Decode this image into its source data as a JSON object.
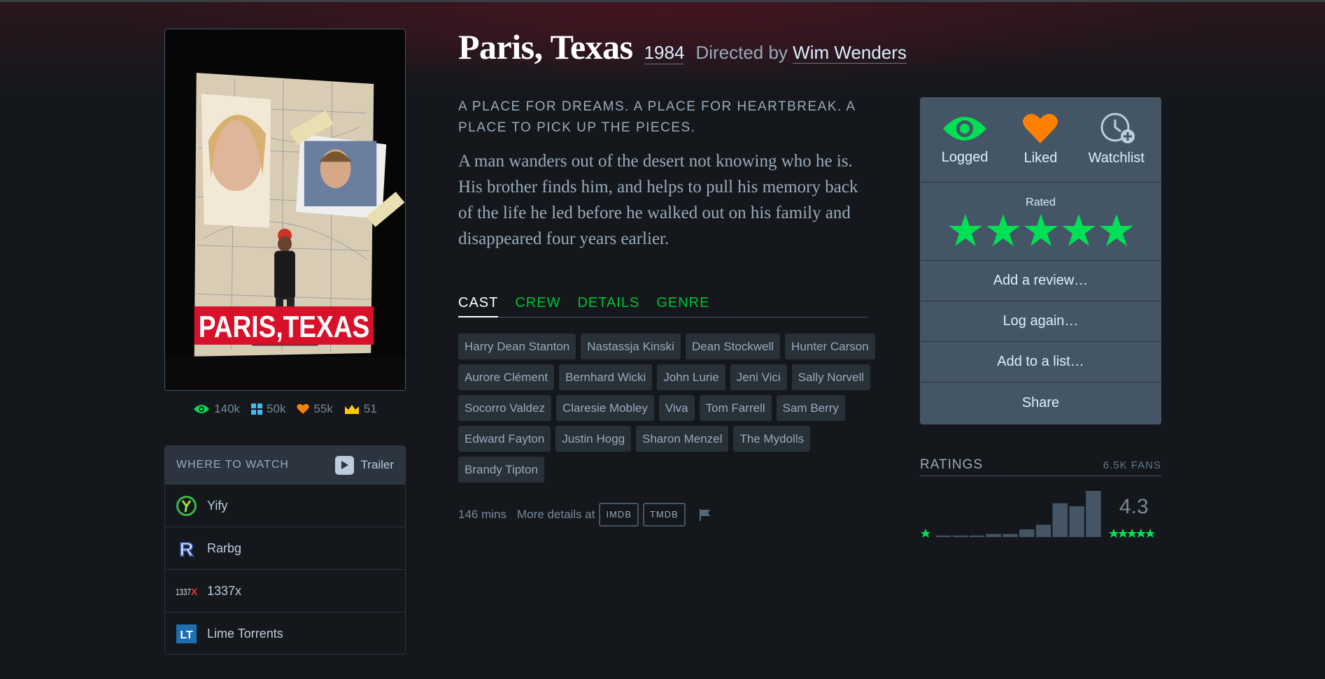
{
  "film": {
    "title": "Paris, Texas",
    "year": "1984",
    "directed_by_label": "Directed by",
    "director": "Wim Wenders",
    "tagline": "A PLACE FOR DREAMS. A PLACE FOR HEARTBREAK. A PLACE TO PICK UP THE PIECES.",
    "synopsis": "A man wanders out of the desert not knowing who he is. His brother finds him, and helps to pull his memory back of the life he led before he walked out on his family and disappeared four years earlier.",
    "poster_title": "PARIS,TEXAS"
  },
  "stats": {
    "watched": "140k",
    "lists": "50k",
    "likes": "55k",
    "top": "51"
  },
  "where_to_watch": {
    "title": "WHERE TO WATCH",
    "trailer_label": "Trailer",
    "services": [
      {
        "name": "Yify",
        "icon": "yify-icon"
      },
      {
        "name": "Rarbg",
        "icon": "rarbg-icon"
      },
      {
        "name": "1337x",
        "icon": "1337x-icon"
      },
      {
        "name": "Lime Torrents",
        "icon": "limetorrents-icon"
      }
    ],
    "icon_text": {
      "rarbg": "R",
      "x1337_a": "1337",
      "x1337_b": "X",
      "lime": "LT"
    }
  },
  "tabs": [
    {
      "label": "CAST",
      "active": true
    },
    {
      "label": "CREW",
      "active": false
    },
    {
      "label": "DETAILS",
      "active": false
    },
    {
      "label": "GENRE",
      "active": false
    }
  ],
  "cast": [
    "Harry Dean Stanton",
    "Nastassja Kinski",
    "Dean Stockwell",
    "Hunter Carson",
    "Aurore Clément",
    "Bernhard Wicki",
    "John Lurie",
    "Jeni Vici",
    "Sally Norvell",
    "Socorro Valdez",
    "Claresie Mobley",
    "Viva",
    "Tom Farrell",
    "Sam Berry",
    "Edward Fayton",
    "Justin Hogg",
    "Sharon Menzel",
    "The Mydolls",
    "Brandy Tipton"
  ],
  "meta": {
    "runtime": "146 mins",
    "more_details": "More details at",
    "imdb": "IMDB",
    "tmdb": "TMDB"
  },
  "actions": {
    "logged": "Logged",
    "liked": "Liked",
    "watchlist": "Watchlist",
    "rated_label": "Rated",
    "user_rating": 5,
    "add_review": "Add a review…",
    "log_again": "Log again…",
    "add_to_list": "Add to a list…",
    "share": "Share"
  },
  "ratings": {
    "title": "RATINGS",
    "fans": "6.5K FANS",
    "average": "4.3",
    "histogram": [
      0.5,
      0.5,
      0.5,
      1,
      1,
      2.5,
      4,
      11,
      10,
      15
    ]
  },
  "colors": {
    "green": "#00e054",
    "orange": "#ff8000",
    "blue": "#40bcf4",
    "bg": "#14181c",
    "panel": "#445566"
  }
}
